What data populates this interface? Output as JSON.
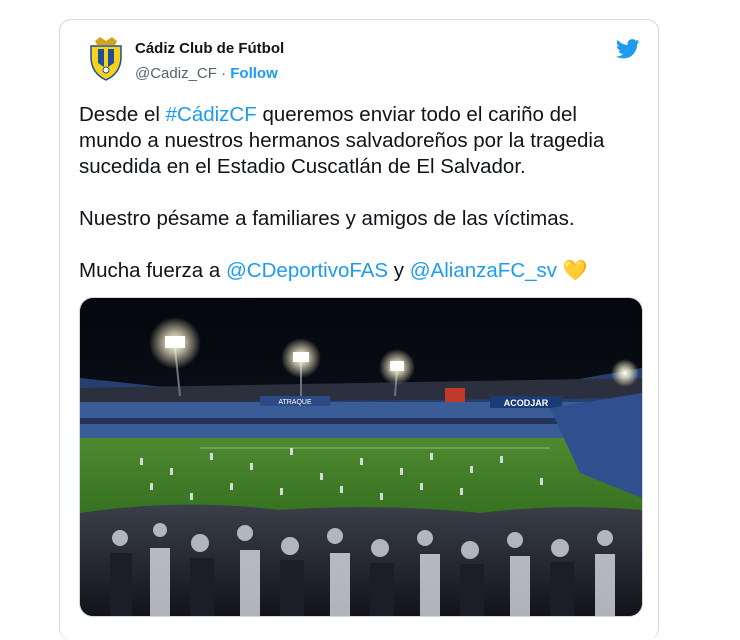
{
  "tweet": {
    "author_name": "Cádiz Club de Fútbol",
    "handle": "@Cadiz_CF",
    "separator": "·",
    "follow_label": "Follow",
    "brand_color": "#1d9bf0",
    "text": {
      "p1": {
        "before": "Desde el ",
        "hashtag": "#CádizCF",
        "after_line1": " queremos enviar todo el cariño del",
        "line2": "mundo a nuestros hermanos salvadoreños por la tragedia",
        "line3": "sucedida en el Estadio Cuscatlán de El Salvador."
      },
      "p2": "Nuestro pésame a familiares y amigos de las víctimas.",
      "p3": {
        "before": "Mucha fuerza a ",
        "mention1": "@CDeportivoFAS",
        "between": " y ",
        "mention2": "@AlianzaFC_sv",
        "emoji": "💛"
      }
    },
    "photo": {
      "ad_board_1": "ACODJAR",
      "ad_board_2": "ATRAQUE"
    },
    "icons": {
      "avatar": "cadiz-crest-icon",
      "brand": "twitter-bird-icon"
    }
  }
}
